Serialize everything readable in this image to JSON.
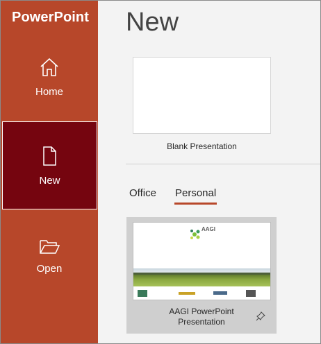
{
  "app": {
    "title": "PowerPoint"
  },
  "sidebar": {
    "items": [
      {
        "label": "Home",
        "icon": "home-icon"
      },
      {
        "label": "New",
        "icon": "new-document-icon",
        "selected": true
      },
      {
        "label": "Open",
        "icon": "folder-open-icon"
      }
    ]
  },
  "main": {
    "title": "New",
    "blank": {
      "label": "Blank Presentation"
    },
    "tabs": [
      {
        "label": "Office",
        "selected": false
      },
      {
        "label": "Personal",
        "selected": true
      }
    ],
    "templates": [
      {
        "label": "AAGI PowerPoint Presentation",
        "logo_text": "AAGI",
        "pinned_icon": "pin-icon"
      }
    ]
  },
  "colors": {
    "brand": "#b7472a",
    "selected_nav": "#75050f",
    "background": "#f3f3f3"
  }
}
